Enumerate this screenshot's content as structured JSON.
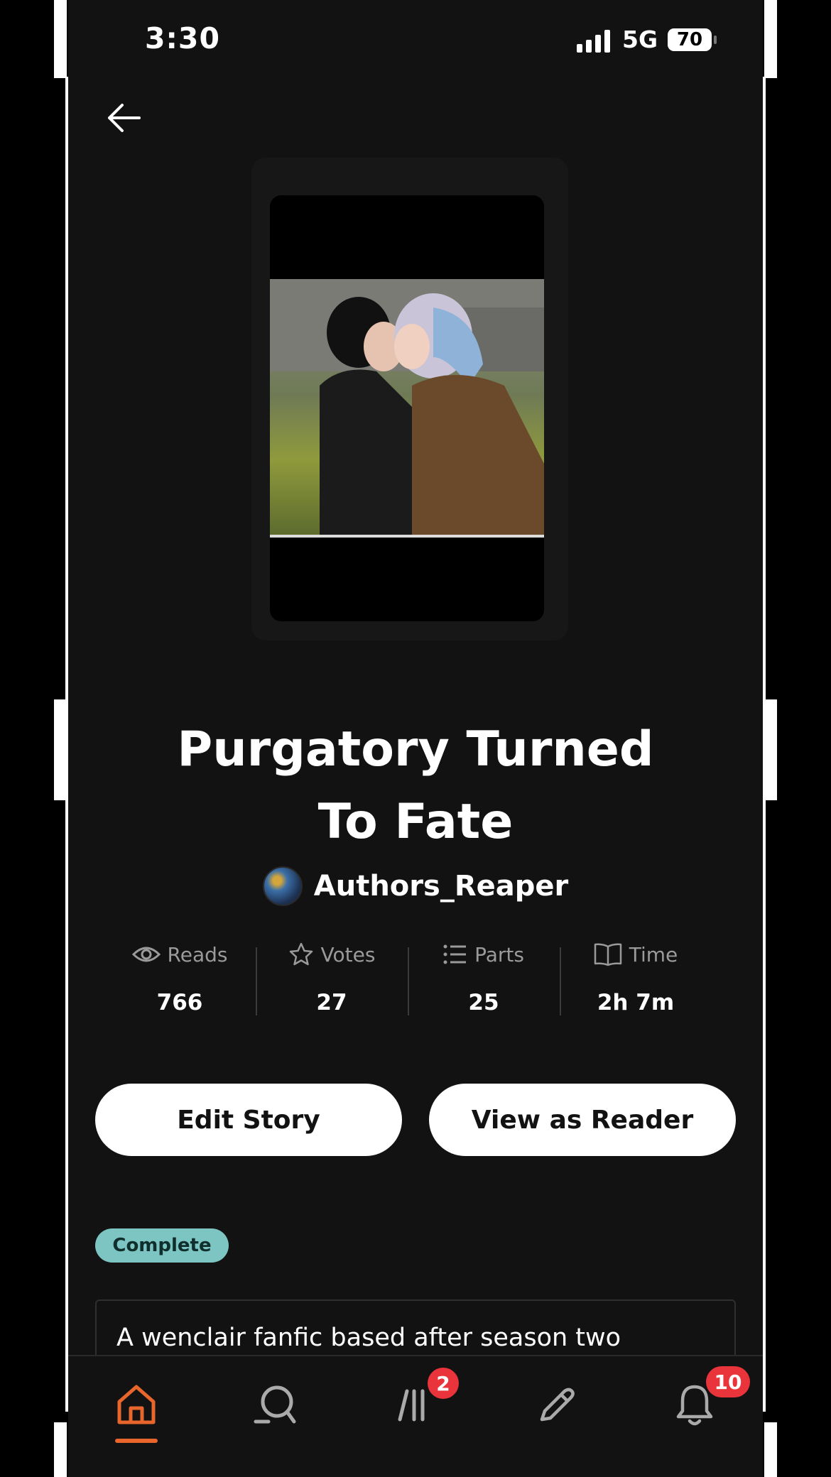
{
  "status_bar": {
    "time": "3:30",
    "network": "5G",
    "battery": "70"
  },
  "story": {
    "title_line1": "Purgatory Turned",
    "title_line2": "To Fate",
    "author": "Authors_Reaper",
    "status": "Complete",
    "description": "A wenclair fanfic based after season two"
  },
  "stats": [
    {
      "icon": "eye-icon",
      "label": "Reads",
      "value": "766"
    },
    {
      "icon": "star-icon",
      "label": "Votes",
      "value": "27"
    },
    {
      "icon": "list-icon",
      "label": "Parts",
      "value": "25"
    },
    {
      "icon": "book-icon",
      "label": "Time",
      "value": "2h 7m"
    }
  ],
  "actions": {
    "edit": "Edit Story",
    "view": "View as Reader"
  },
  "nav": {
    "active": "home",
    "library_badge": "2",
    "notifications_badge": "10"
  },
  "colors": {
    "accent": "#e8652b",
    "complete_badge": "#7cc5c2",
    "notification": "#e8343a",
    "background": "#121212"
  }
}
